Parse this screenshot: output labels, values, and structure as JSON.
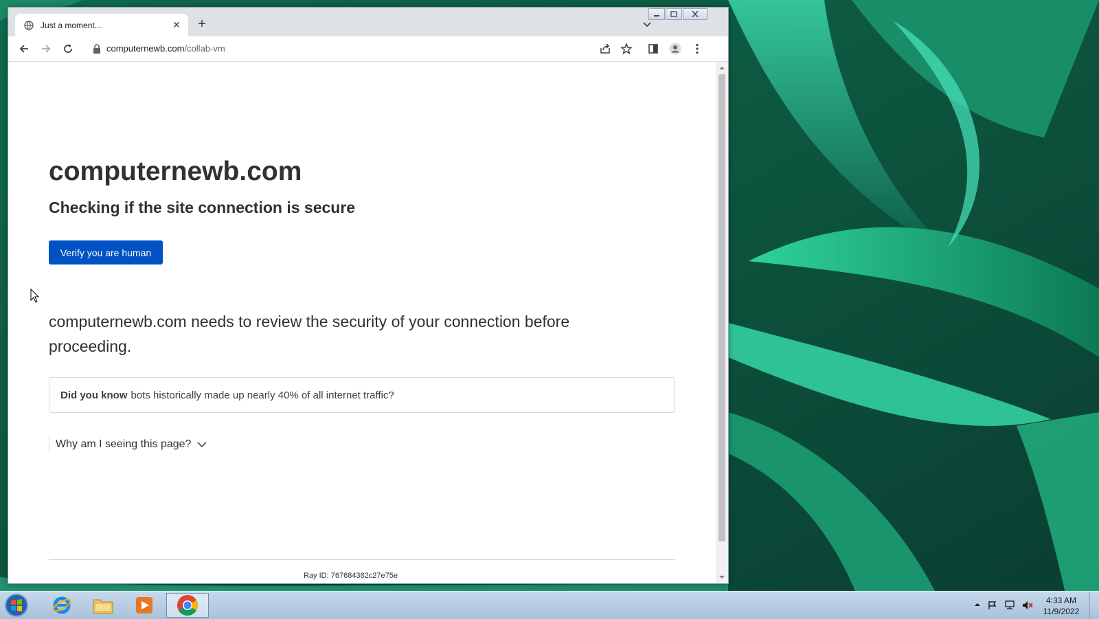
{
  "tab": {
    "title": "Just a moment...",
    "favicon": "globe-icon"
  },
  "address_bar": {
    "domain": "computernewb.com",
    "path": "/collab-vm"
  },
  "page": {
    "site_name": "computernewb.com",
    "subtitle": "Checking if the site connection is secure",
    "verify_button": "Verify you are human",
    "review_text": "computernewb.com needs to review the security of your connection before proceeding.",
    "did_you_know_lead": "Did you know",
    "did_you_know_text": "bots historically made up nearly 40% of all internet traffic?",
    "why_label": "Why am I seeing this page?",
    "ray_id": "Ray ID: 767684382c27e75e"
  },
  "taskbar": {
    "apps": [
      "internet-explorer-icon",
      "file-explorer-icon",
      "media-player-icon",
      "chrome-icon"
    ],
    "time": "4:33 AM",
    "date": "11/9/2022"
  },
  "colors": {
    "accent": "#0051c3",
    "tabstrip": "#dee1e6"
  }
}
